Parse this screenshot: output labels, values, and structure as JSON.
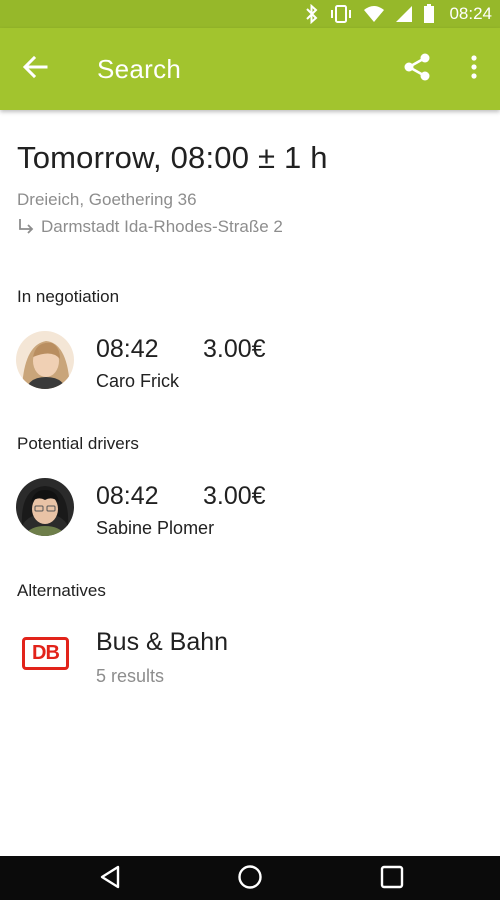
{
  "status_bar": {
    "time": "08:24",
    "icons": [
      "bluetooth-icon",
      "vibrate-icon",
      "wifi-icon",
      "signal-icon",
      "battery-icon"
    ]
  },
  "app_bar": {
    "title": "Search",
    "back_icon": "arrow-back-icon",
    "share_icon": "share-icon",
    "more_icon": "more-vert-icon",
    "color": "#a2c42e"
  },
  "trip": {
    "time": "Tomorrow, 08:00 ± 1 h",
    "origin": "Dreieich, Goethering 36",
    "destination": "Darmstadt Ida-Rhodes-Straße 2"
  },
  "sections": {
    "negotiation": {
      "title": "In negotiation",
      "items": [
        {
          "time": "08:42",
          "price": "3.00€",
          "name": "Caro Frick"
        }
      ]
    },
    "potential": {
      "title": "Potential drivers",
      "items": [
        {
          "time": "08:42",
          "price": "3.00€",
          "name": "Sabine Plomer"
        }
      ]
    },
    "alternatives": {
      "title": "Alternatives",
      "items": [
        {
          "logo": "DB",
          "title": "Bus & Bahn",
          "subtitle": "5 results"
        }
      ]
    }
  },
  "nav_bar": {
    "buttons": [
      "back-triangle-icon",
      "home-circle-icon",
      "recents-square-icon"
    ]
  }
}
